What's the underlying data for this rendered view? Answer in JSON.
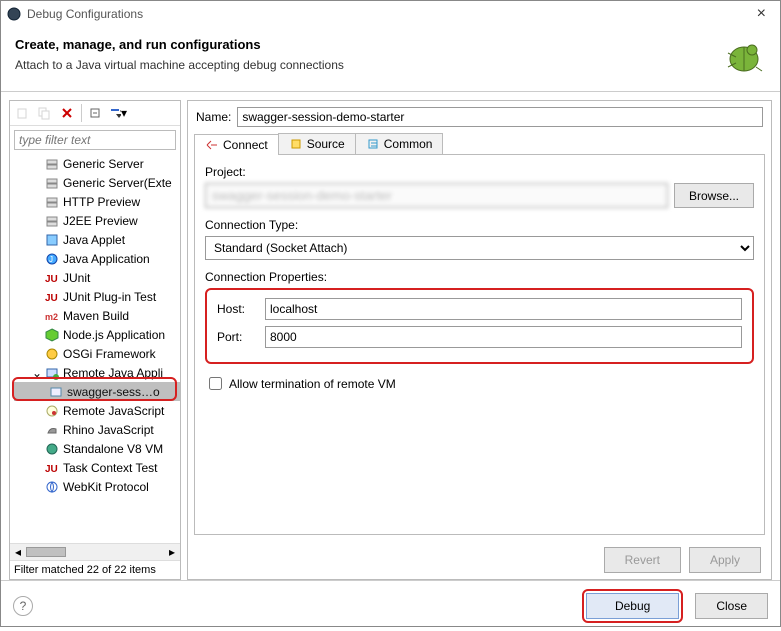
{
  "window": {
    "title": "Debug Configurations"
  },
  "header": {
    "title": "Create, manage, and run configurations",
    "subtitle": "Attach to a Java virtual machine accepting debug connections"
  },
  "sidebar": {
    "filter_placeholder": "type filter text",
    "items": [
      {
        "label": "Generic Server",
        "icon": "server"
      },
      {
        "label": "Generic Server(Exte",
        "icon": "server"
      },
      {
        "label": "HTTP Preview",
        "icon": "server"
      },
      {
        "label": "J2EE Preview",
        "icon": "server"
      },
      {
        "label": "Java Applet",
        "icon": "applet"
      },
      {
        "label": "Java Application",
        "icon": "java"
      },
      {
        "label": "JUnit",
        "icon": "junit"
      },
      {
        "label": "JUnit Plug-in Test",
        "icon": "junit"
      },
      {
        "label": "Maven Build",
        "icon": "maven"
      },
      {
        "label": "Node.js Application",
        "icon": "node"
      },
      {
        "label": "OSGi Framework",
        "icon": "osgi"
      },
      {
        "label": "Remote Java Appli",
        "icon": "remote",
        "expanded": true
      },
      {
        "label": "swagger-sess…o",
        "icon": "config",
        "child": true,
        "selected": true
      },
      {
        "label": "Remote JavaScript",
        "icon": "js"
      },
      {
        "label": "Rhino JavaScript",
        "icon": "rhino"
      },
      {
        "label": "Standalone V8 VM",
        "icon": "v8"
      },
      {
        "label": "Task Context Test",
        "icon": "junit"
      },
      {
        "label": "WebKit Protocol",
        "icon": "webkit"
      }
    ],
    "filter_status": "Filter matched 22 of 22 items"
  },
  "form": {
    "name_label": "Name:",
    "name_value": "swagger-session-demo-starter",
    "tabs": [
      {
        "label": "Connect",
        "icon": "connect"
      },
      {
        "label": "Source",
        "icon": "source"
      },
      {
        "label": "Common",
        "icon": "common"
      }
    ],
    "project_label": "Project:",
    "project_value": "swagger-session-demo-starter",
    "browse_label": "Browse...",
    "conn_type_label": "Connection Type:",
    "conn_type_value": "Standard (Socket Attach)",
    "conn_props_label": "Connection Properties:",
    "host_label": "Host:",
    "host_value": "localhost",
    "port_label": "Port:",
    "port_value": "8000",
    "allow_term_label": "Allow termination of remote VM",
    "allow_term_checked": false,
    "revert_label": "Revert",
    "apply_label": "Apply"
  },
  "footer": {
    "debug_label": "Debug",
    "close_label": "Close"
  }
}
